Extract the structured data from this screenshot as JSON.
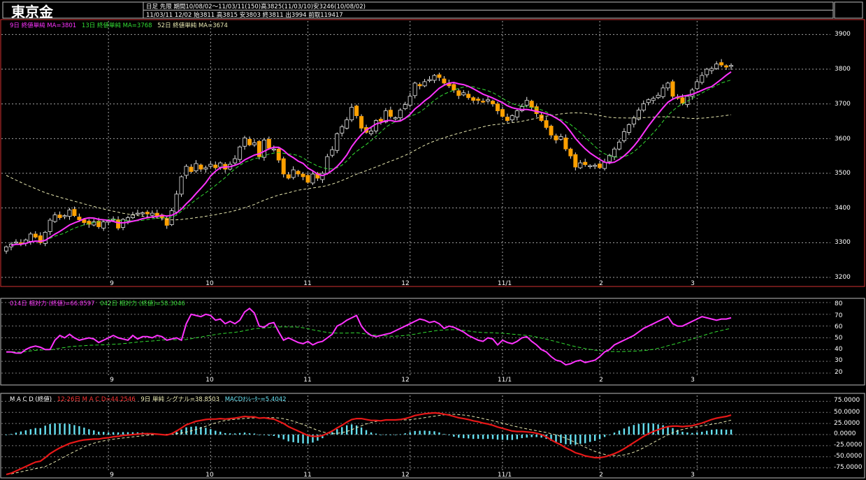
{
  "header": {
    "title": "東京金",
    "line1": "日足 先限 期間10/08/02～11/03/11(150)高3825(11/03/10)安3246(10/08/02)",
    "line2": "11/03/11 12/02 始3811 高3815 安3803 終3811 出3994 前取119417"
  },
  "colors": {
    "up": "#000000",
    "down": "#ffa000",
    "wick": "#e6e6e6",
    "ma9": "#ff33ff",
    "ma13": "#33dd33",
    "ma52": "#e8e8b0",
    "rsi14": "#ff33ff",
    "rsi42": "#33dd33",
    "macd": "#e81818",
    "signal": "#e8e8b0",
    "osc": "#66e0f0",
    "grid": "#cfcfcf",
    "frame_main": "#d23030",
    "frame_sub": "#bbbbbb"
  },
  "price_panel": {
    "legend": [
      {
        "text": "9日 終値単純 MA=3801",
        "color": "#ff33ff"
      },
      {
        "text": "13日 終値単純 MA=3768",
        "color": "#33dd33"
      },
      {
        "text": "52日 終値単純 MA=3674",
        "color": "#e8e8b0"
      }
    ],
    "y_ticks": [
      "3900",
      "3800",
      "3700",
      "3600",
      "3500",
      "3400",
      "3300",
      "3200"
    ]
  },
  "rsi_panel": {
    "legend": [
      {
        "text": "014日 相対力 (終値)=66.8597",
        "color": "#ff33ff"
      },
      {
        "text": "042日 相対力 (終値)=58.3046",
        "color": "#33dd33"
      }
    ],
    "y_ticks": [
      "80",
      "70",
      "60",
      "50",
      "40",
      "30",
      "20"
    ]
  },
  "macd_panel": {
    "legend": [
      {
        "text": "M A C D (終値)",
        "color": "#ffffff"
      },
      {
        "text": "12-26日 M A C D=44.2546",
        "color": "#ff3333"
      },
      {
        "text": "9日 単純 シグナル=38.8503",
        "color": "#e8e8b0"
      },
      {
        "text": "MACDｵｼﾚｰﾀｰ=5.4042",
        "color": "#66e0f0"
      }
    ],
    "y_ticks": [
      "75.0000",
      "50.0000",
      "25.0000",
      "0.0000",
      "-25.0000",
      "-50.0000",
      "-75.0000"
    ]
  },
  "x_labels": [
    "9",
    "10",
    "11",
    "12",
    "11/1",
    "2",
    "3"
  ],
  "chart_data": [
    {
      "type": "candlestick",
      "title": "東京金",
      "period": "10/08/02～11/03/11",
      "ylim": [
        3200,
        3950
      ],
      "y_ticks": [
        3900,
        3800,
        3700,
        3600,
        3500,
        3400,
        3300,
        3200
      ],
      "x_label_day_index": {
        "9": 21,
        "10": 42,
        "11": 62,
        "12": 83,
        "11/1": 102,
        "2": 122,
        "3": 142
      },
      "close": [
        3288,
        3296,
        3302,
        3296,
        3308,
        3325,
        3316,
        3300,
        3330,
        3365,
        3380,
        3372,
        3378,
        3394,
        3378,
        3366,
        3358,
        3353,
        3360,
        3346,
        3360,
        3362,
        3368,
        3342,
        3367,
        3372,
        3381,
        3385,
        3386,
        3383,
        3385,
        3376,
        3372,
        3350,
        3392,
        3440,
        3490,
        3520,
        3505,
        3528,
        3512,
        3516,
        3526,
        3516,
        3530,
        3512,
        3526,
        3542,
        3576,
        3602,
        3582,
        3588,
        3548,
        3596,
        3572,
        3570,
        3538,
        3498,
        3486,
        3510,
        3498,
        3490,
        3474,
        3498,
        3486,
        3500,
        3548,
        3568,
        3614,
        3634,
        3654,
        3690,
        3666,
        3630,
        3618,
        3622,
        3652,
        3650,
        3680,
        3664,
        3660,
        3682,
        3698,
        3722,
        3760,
        3752,
        3764,
        3770,
        3782,
        3776,
        3760,
        3752,
        3740,
        3724,
        3732,
        3718,
        3710,
        3710,
        3706,
        3712,
        3700,
        3680,
        3664,
        3652,
        3666,
        3680,
        3692,
        3710,
        3690,
        3672,
        3652,
        3632,
        3610,
        3596,
        3606,
        3570,
        3550,
        3518,
        3530,
        3525,
        3522,
        3523,
        3516,
        3532,
        3552,
        3570,
        3590,
        3620,
        3640,
        3660,
        3682,
        3700,
        3712,
        3716,
        3725,
        3746,
        3760,
        3722,
        3716,
        3702,
        3722,
        3740,
        3764,
        3782,
        3800,
        3802,
        3815,
        3812,
        3806,
        3811
      ],
      "series": [
        {
          "name": "9日 終値単純 MA",
          "last": 3801
        },
        {
          "name": "13日 終値単純 MA",
          "last": 3768
        },
        {
          "name": "52日 終値単純 MA",
          "last": 3674
        }
      ]
    },
    {
      "type": "line",
      "ylim": [
        20,
        80
      ],
      "y_ticks": [
        80,
        70,
        60,
        50,
        40,
        30,
        20
      ],
      "series": [
        {
          "name": "014日 相対力 (終値)",
          "last": 66.8597,
          "values": [
            38,
            38,
            37,
            37,
            40,
            42,
            43,
            42,
            40,
            40,
            48,
            52,
            50,
            53,
            50,
            48,
            49,
            50,
            49,
            46,
            48,
            50,
            52,
            50,
            49,
            48,
            52,
            49,
            51,
            51,
            50,
            52,
            51,
            48,
            49,
            50,
            48,
            62,
            70,
            69,
            68,
            70,
            69,
            65,
            66,
            62,
            64,
            62,
            65,
            72,
            75,
            71,
            60,
            59,
            62,
            63,
            55,
            48,
            50,
            48,
            46,
            45,
            47,
            44,
            46,
            47,
            50,
            53,
            60,
            62,
            65,
            67,
            69,
            60,
            55,
            52,
            51,
            52,
            53,
            54,
            56,
            58,
            60,
            62,
            64,
            66,
            65,
            63,
            64,
            62,
            58,
            60,
            59,
            57,
            55,
            52,
            50,
            48,
            47,
            50,
            49,
            44,
            48,
            46,
            45,
            47,
            50,
            51,
            47,
            44,
            40,
            38,
            34,
            31,
            30,
            27,
            28,
            30,
            31,
            29,
            30,
            31,
            34,
            38,
            40,
            44,
            46,
            48,
            50,
            52,
            55,
            58,
            60,
            62,
            64,
            66,
            68,
            62,
            60,
            60,
            62,
            64,
            66,
            68,
            67,
            66,
            65,
            66,
            66,
            67
          ]
        },
        {
          "name": "042日 相対力 (終値)",
          "last": 58.3046
        }
      ]
    },
    {
      "type": "line",
      "ylim": [
        -100,
        95
      ],
      "y_ticks": [
        75,
        50,
        25,
        0,
        -25,
        -50,
        -75
      ],
      "series": [
        {
          "name": "12-26日 M A C D",
          "last": 44.2546,
          "values": [
            -90,
            -87,
            -82,
            -77,
            -72,
            -67,
            -62,
            -60,
            -52,
            -43,
            -36,
            -30,
            -25,
            -20,
            -17,
            -14,
            -12,
            -11,
            -10,
            -10,
            -8,
            -7,
            -5,
            -4,
            -2,
            -1,
            0,
            1,
            2,
            2,
            2,
            1,
            0,
            -1,
            2,
            8,
            15,
            22,
            26,
            30,
            32,
            34,
            35,
            35,
            36,
            35,
            36,
            37,
            39,
            41,
            40,
            40,
            37,
            38,
            36,
            35,
            30,
            25,
            18,
            13,
            8,
            3,
            -2,
            -4,
            -4,
            -2,
            3,
            8,
            15,
            21,
            28,
            34,
            36,
            36,
            34,
            32,
            32,
            31,
            33,
            33,
            33,
            34,
            36,
            39,
            43,
            45,
            47,
            48,
            49,
            48,
            46,
            44,
            41,
            38,
            36,
            34,
            31,
            29,
            26,
            24,
            21,
            17,
            14,
            11,
            8,
            7,
            7,
            6,
            5,
            3,
            0,
            -5,
            -12,
            -18,
            -23,
            -30,
            -35,
            -41,
            -44,
            -48,
            -50,
            -52,
            -52,
            -50,
            -47,
            -43,
            -38,
            -32,
            -25,
            -18,
            -11,
            -4,
            2,
            7,
            11,
            15,
            18,
            19,
            19,
            18,
            19,
            20,
            23,
            26,
            30,
            34,
            37,
            39,
            41,
            44
          ]
        },
        {
          "name": "9日 単純 シグナル",
          "last": 38.8503
        },
        {
          "name": "MACDｵｼﾚｰﾀｰ",
          "last": 5.4042
        }
      ]
    }
  ]
}
